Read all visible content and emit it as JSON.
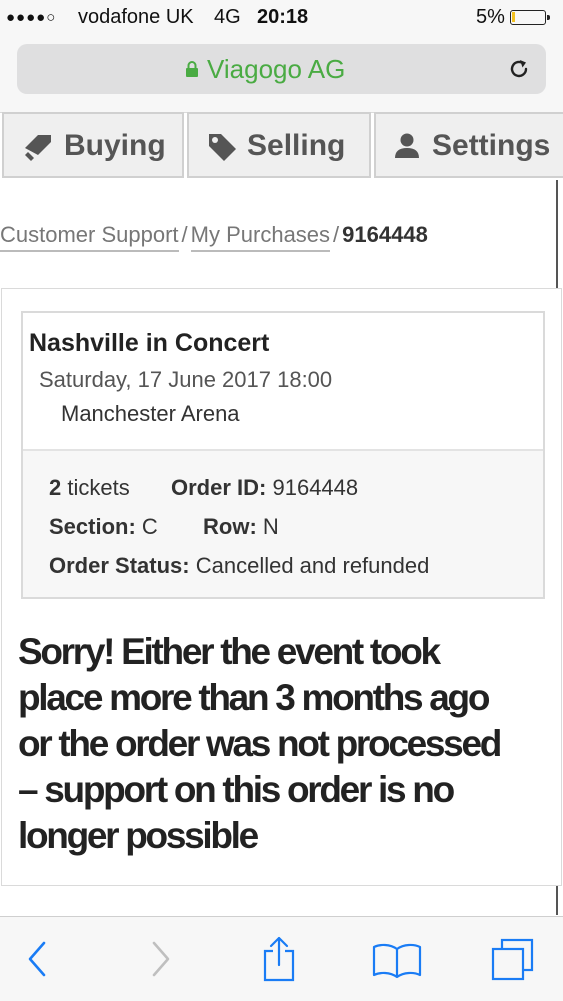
{
  "status_bar": {
    "signal": "●●●●○",
    "carrier": "vodafone UK",
    "network": "4G",
    "time": "20:18",
    "battery": "5%",
    "battery_level": 0.05,
    "battery_color": "#f2c01e"
  },
  "address_bar": {
    "domain": "Viagogo AG",
    "lock_icon": "lock-icon",
    "reload_icon": "reload-icon",
    "accent": "#4aab43"
  },
  "tabs": [
    {
      "label": "Buying",
      "icon": "tag-icon"
    },
    {
      "label": "Selling",
      "icon": "price-tag-icon"
    },
    {
      "label": "Settings",
      "icon": "user-icon"
    }
  ],
  "breadcrumb": {
    "items": [
      "Customer Support",
      "My Purchases"
    ],
    "separator": "/",
    "current": "9164448"
  },
  "order": {
    "event_title": "Nashville in Concert",
    "date": "Saturday, 17 June 2017 18:00",
    "venue": "Manchester Arena",
    "tickets_count": "2",
    "tickets_label": "tickets",
    "order_id_label": "Order ID:",
    "order_id": "9164448",
    "section_label": "Section:",
    "section": "C",
    "row_label": "Row:",
    "row": "N",
    "status_label": "Order Status:",
    "status": "Cancelled and refunded"
  },
  "message": {
    "line1": "Sorry! Either the event took",
    "line2": "place more than 3 months ago",
    "line3": "or the order was not processed",
    "line4": "– support on this order is no",
    "line5": "longer possible"
  },
  "toolbar": {
    "icons": [
      "back-icon",
      "forward-icon",
      "share-icon",
      "bookmarks-icon",
      "tabs-icon"
    ],
    "accent": "#1a7cf5"
  }
}
